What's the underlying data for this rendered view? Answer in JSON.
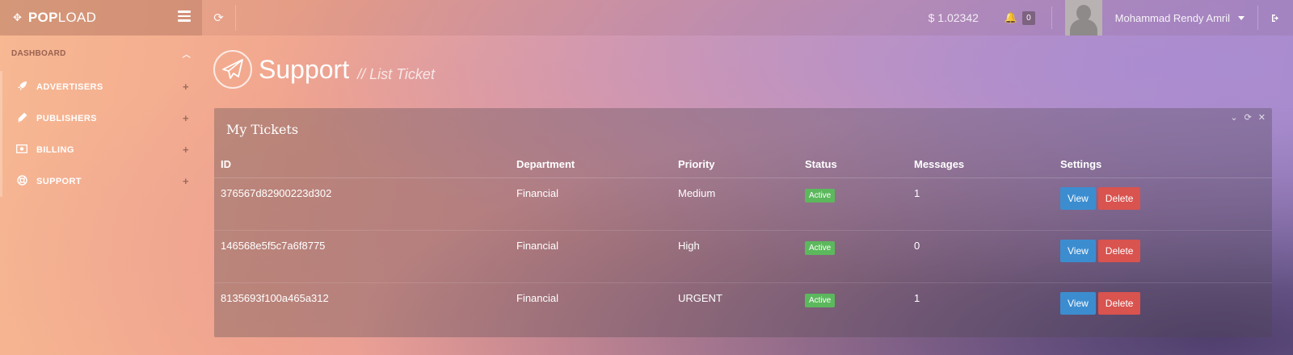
{
  "brand": {
    "prefix": "POP",
    "suffix": "LOAD"
  },
  "header": {
    "balance": "$ 1.02342",
    "notification_count": "0",
    "user_name": "Mohammad Rendy Amril"
  },
  "sidebar": {
    "section_label": "DASHBOARD",
    "items": [
      {
        "label": "ADVERTISERS",
        "icon": "rocket-icon"
      },
      {
        "label": "PUBLISHERS",
        "icon": "pencil-icon"
      },
      {
        "label": "BILLING",
        "icon": "money-icon"
      },
      {
        "label": "SUPPORT",
        "icon": "lifebuoy-icon"
      }
    ]
  },
  "page": {
    "title": "Support",
    "subtitle": "// List Ticket"
  },
  "panel": {
    "title": "My Tickets",
    "columns": [
      "ID",
      "Department",
      "Priority",
      "Status",
      "Messages",
      "Settings"
    ],
    "rows": [
      {
        "id": "376567d82900223d302",
        "department": "Financial",
        "priority": "Medium",
        "status": "Active",
        "messages": "1",
        "view": "View",
        "delete": "Delete"
      },
      {
        "id": "146568e5f5c7a6f8775",
        "department": "Financial",
        "priority": "High",
        "status": "Active",
        "messages": "0",
        "view": "View",
        "delete": "Delete"
      },
      {
        "id": "8135693f100a465a312",
        "department": "Financial",
        "priority": "URGENT",
        "status": "Active",
        "messages": "1",
        "view": "View",
        "delete": "Delete"
      }
    ]
  },
  "colors": {
    "active_badge": "#5cb85c",
    "view_button": "#3c8dd0",
    "delete_button": "#d9534f"
  }
}
